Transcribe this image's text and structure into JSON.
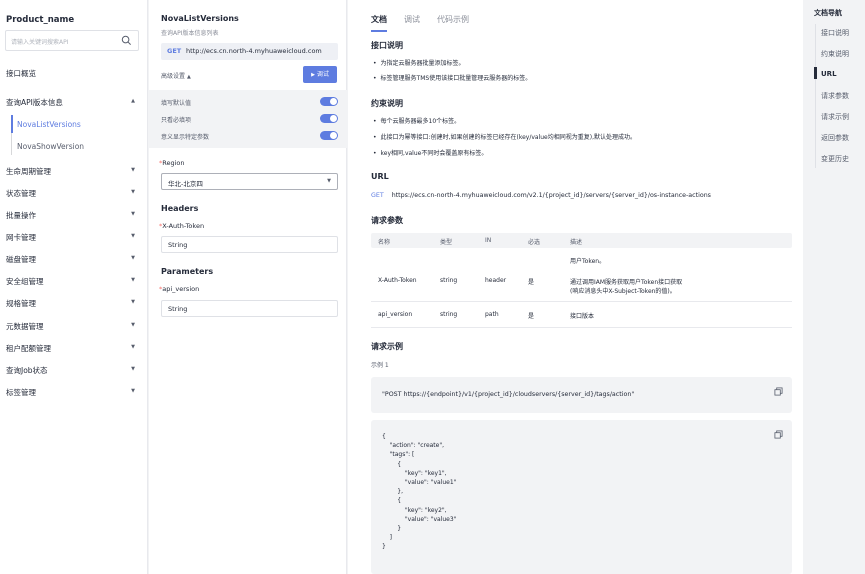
{
  "sidebar": {
    "product_name": "Product_name",
    "search_placeholder": "请输入关键词搜索API",
    "items": [
      {
        "label": "接口概览"
      },
      {
        "label": "查询API版本信息"
      },
      {
        "label": "生命周期管理"
      },
      {
        "label": "状态管理"
      },
      {
        "label": "批量操作"
      },
      {
        "label": "网卡管理"
      },
      {
        "label": "磁盘管理"
      },
      {
        "label": "安全组管理"
      },
      {
        "label": "规格管理"
      },
      {
        "label": "元数据管理"
      },
      {
        "label": "租户配额管理"
      },
      {
        "label": "查询Job状态"
      },
      {
        "label": "标签管理"
      }
    ],
    "sub_items": [
      {
        "label": "NovaListVersions"
      },
      {
        "label": "NovaShowVersion"
      }
    ]
  },
  "debug_panel": {
    "api_name": "NovaListVersions",
    "api_desc": "查询API版本信息列表",
    "method": "GET",
    "url": "http://ecs.cn.north-4.myhuaweicloud.com",
    "advanced_label": "高级设置",
    "debug_button": "调试",
    "toggles": [
      {
        "label": "填写默认值",
        "on": true
      },
      {
        "label": "只看必填项",
        "on": true
      },
      {
        "label": "意义显示特定参数",
        "on": true
      }
    ],
    "region_label": "Region",
    "region_value": "华北-北京四",
    "headers_title": "Headers",
    "header_param_label": "X-Auth-Token",
    "header_param_value": "String",
    "parameters_title": "Parameters",
    "param_label": "api_version",
    "param_value": "String"
  },
  "main": {
    "tabs": [
      {
        "label": "文档"
      },
      {
        "label": "调试"
      },
      {
        "label": "代码示例"
      }
    ],
    "interface_title": "接口说明",
    "interface_bullets": [
      "为指定云服务器批量添加标签。",
      "标签管理服务TMS使用该接口批量管理云服务器的标签。"
    ],
    "constraints_title": "约束说明",
    "constraint_bullets": [
      "每个云服务器最多10个标签。",
      "此接口为幂等接口:创建时,如果创建的标签已经存在(key/value均相同视为重复),默认处理成功。",
      "key相同,value不同时会覆盖原有标签。"
    ],
    "url_title": "URL",
    "url_method": "GET",
    "url_value": "https://ecs.cn-north-4.myhuaweicloud.com/v2.1/{project_id}/servers/{server_id}/os-instance-actions",
    "params_title": "请求参数",
    "table_headers": [
      "名称",
      "类型",
      "IN",
      "必选",
      "描述"
    ],
    "table_rows": [
      {
        "name": "X-Auth-Token",
        "type": "string",
        "in": "header",
        "required": "是",
        "desc_lines": [
          "用户Token。",
          "通过调用IAM服务获取用户Token接口获取",
          "(响应消息头中X-Subject-Token的值)。"
        ]
      },
      {
        "name": "api_version",
        "type": "string",
        "in": "path",
        "required": "是",
        "desc_lines": [
          "接口版本"
        ]
      }
    ],
    "example_title": "请求示例",
    "example_label": "示例 1",
    "example_request": "\"POST https://{endpoint}/v1/{project_id}/cloudservers/{server_id}/tags/action\"",
    "example_body": "{\n    \"action\": \"create\",\n    \"tags\": [\n        {\n            \"key\": \"key1\",\n            \"value\": \"value1\"\n        },\n        {\n            \"key\": \"key2\",\n            \"value\": \"value3\"\n        }\n    ]\n}"
  },
  "toc": {
    "title": "文档导航",
    "items": [
      {
        "label": "接口说明"
      },
      {
        "label": "约束说明"
      },
      {
        "label": "URL"
      },
      {
        "label": "请求参数"
      },
      {
        "label": "请求示例"
      },
      {
        "label": "返回参数"
      },
      {
        "label": "变更历史"
      }
    ],
    "active_index": 2
  },
  "colors": {
    "accent": "#5e7ce0",
    "panel_bg": "#f2f3f5"
  }
}
